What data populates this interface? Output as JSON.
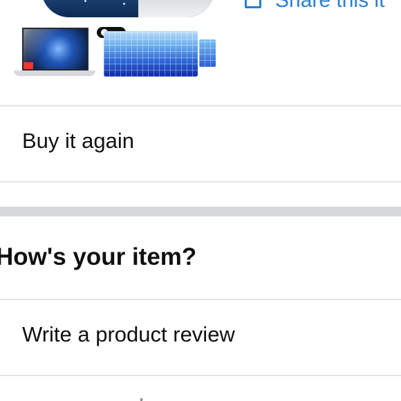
{
  "header": {
    "share_label": "Share this it"
  },
  "product": {
    "images": [
      "laptop-case-image",
      "screen-protector-image",
      "camera-cover-image",
      "keyboard-cover-image"
    ]
  },
  "actions": {
    "buy_again": "Buy it again"
  },
  "review_section": {
    "heading": "How's your item?",
    "write_review": "Write a product review"
  },
  "colors": {
    "link_blue": "#2b7fd1",
    "divider": "#e3e6e6",
    "section_band": "#d5d9d9",
    "text": "#0f1111"
  }
}
